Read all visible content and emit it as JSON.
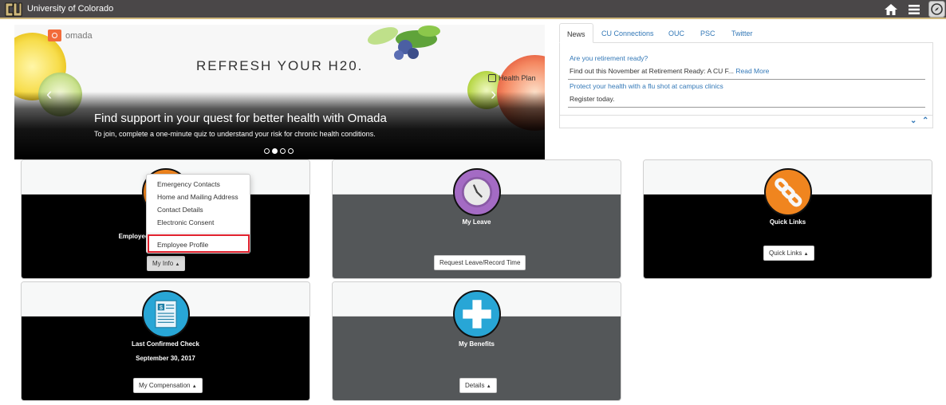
{
  "header": {
    "brand": "University of Colorado",
    "icons": [
      "cu-logo-icon",
      "home-icon",
      "menu-icon",
      "compass-icon"
    ],
    "accent_gold": "#cfb87c",
    "bar_color": "#4a4748"
  },
  "carousel": {
    "brand_logo": "omada",
    "banner_headline": "REFRESH YOUR H20.",
    "partner_label": "Health Plan",
    "title": "Find support in your quest for better health with Omada",
    "subtitle": "To join, complete a one-minute quiz to understand your risk for chronic health conditions.",
    "prev_icon": "‹",
    "next_icon": "›",
    "slides": 4,
    "active_slide": 2
  },
  "news": {
    "tabs": [
      {
        "label": "News",
        "active": true
      },
      {
        "label": "CU Connections",
        "active": false
      },
      {
        "label": "OUC",
        "active": false
      },
      {
        "label": "PSC",
        "active": false
      },
      {
        "label": "Twitter",
        "active": false
      }
    ],
    "items": [
      {
        "headline": "Are you retirement ready?",
        "body": "Find out this November at Retirement Ready: A CU F...",
        "more": "Read More"
      },
      {
        "headline": "Protect your health with a flu shot at campus clinics",
        "body": "Register today."
      }
    ],
    "controls": {
      "down": "⌄",
      "up": "⌃"
    },
    "link_color": "#3378b7"
  },
  "tiles": {
    "employee": {
      "title": "Employee",
      "icon": "user-icon",
      "button": "My Info",
      "menu": {
        "items": [
          "Emergency Contacts",
          "Home and Mailing Address",
          "Contact Details",
          "Electronic Consent"
        ],
        "highlighted": "Employee Profile"
      }
    },
    "leave": {
      "title": "My Leave",
      "icon": "clock-icon",
      "button": "Request Leave/Record Time"
    },
    "links": {
      "title": "Quick Links",
      "icon": "chain-link-icon",
      "button": "Quick Links"
    },
    "check": {
      "title": "Last Confirmed Check",
      "date": "September 30, 2017",
      "icon": "paycheck-icon",
      "button": "My Compensation"
    },
    "benefits": {
      "title": "My Benefits",
      "icon": "medical-cross-icon",
      "button": "Details"
    }
  },
  "colors": {
    "orange_icon": "#f0851f",
    "purple_icon": "#a46bc4",
    "blue_icon": "#28a6d6",
    "highlight_red": "#e0212d"
  }
}
